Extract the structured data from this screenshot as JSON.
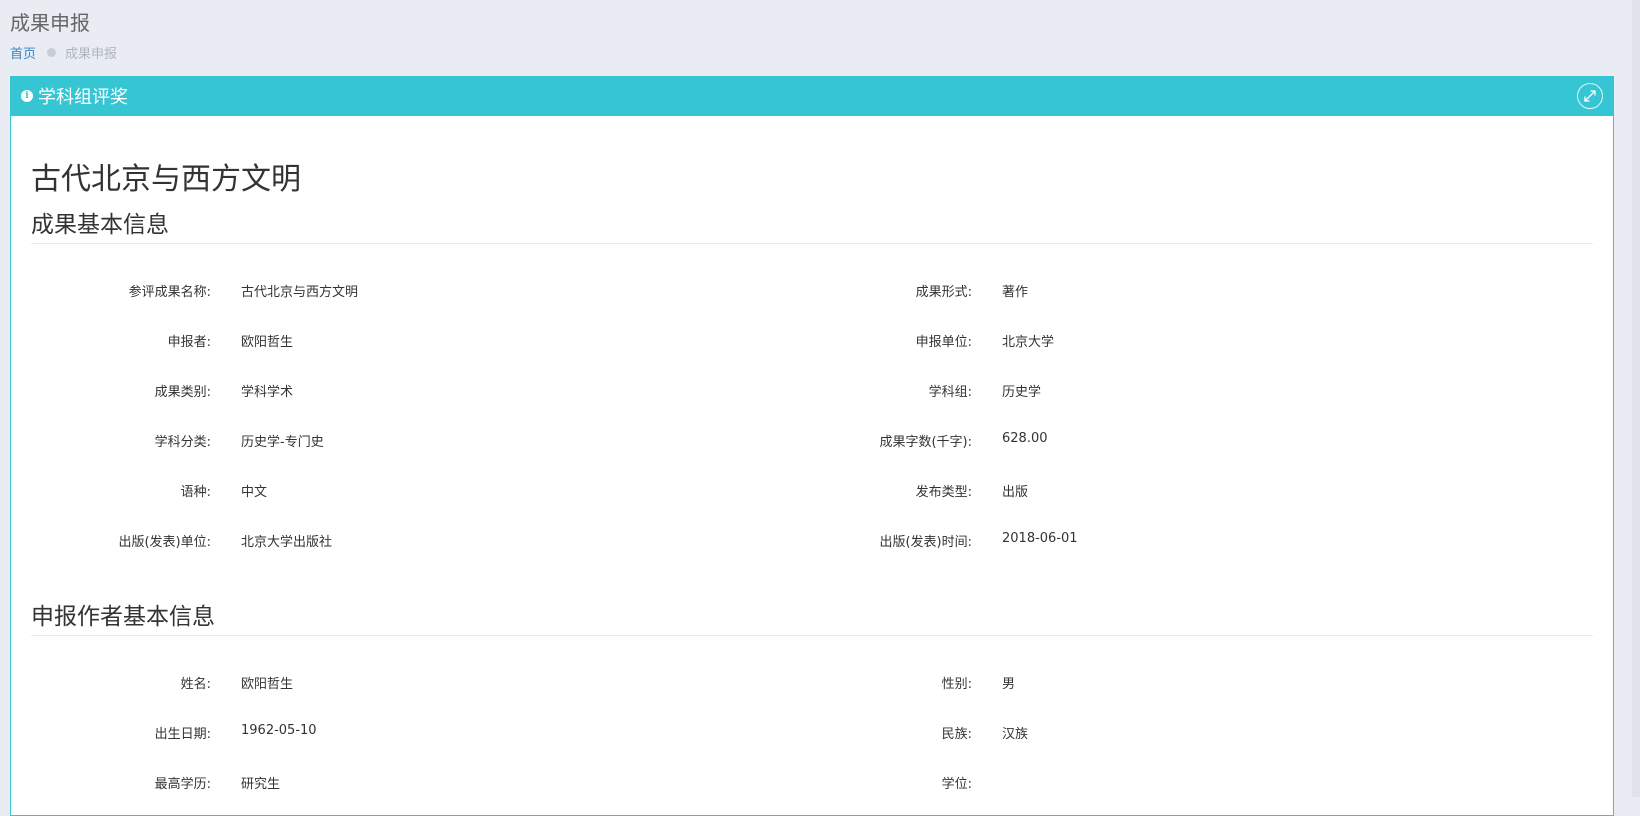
{
  "header": {
    "title": "成果申报",
    "breadcrumb": {
      "home": "首页",
      "current": "成果申报"
    }
  },
  "panel": {
    "title": "学科组评奖",
    "icons": {
      "info": "info-icon",
      "expand": "expand-icon"
    },
    "accent_color": "#36c6d3"
  },
  "doc_title": "古代北京与西方文明",
  "basic_info": {
    "section_title": "成果基本信息",
    "rows": [
      {
        "left_label": "参评成果名称:",
        "left_value": "古代北京与西方文明",
        "right_label": "成果形式:",
        "right_value": "著作"
      },
      {
        "left_label": "申报者:",
        "left_value": "欧阳哲生",
        "right_label": "申报单位:",
        "right_value": "北京大学"
      },
      {
        "left_label": "成果类别:",
        "left_value": "学科学术",
        "right_label": "学科组:",
        "right_value": "历史学"
      },
      {
        "left_label": "学科分类:",
        "left_value": "历史学-专门史",
        "right_label": "成果字数(千字):",
        "right_value": "628.00"
      },
      {
        "left_label": "语种:",
        "left_value": "中文",
        "right_label": "发布类型:",
        "right_value": "出版"
      },
      {
        "left_label": "出版(发表)单位:",
        "left_value": "北京大学出版社",
        "right_label": "出版(发表)时间:",
        "right_value": "2018-06-01"
      }
    ]
  },
  "author_info": {
    "section_title": "申报作者基本信息",
    "rows": [
      {
        "left_label": "姓名:",
        "left_value": "欧阳哲生",
        "right_label": "性别:",
        "right_value": "男"
      },
      {
        "left_label": "出生日期:",
        "left_value": "1962-05-10",
        "right_label": "民族:",
        "right_value": "汉族"
      },
      {
        "left_label": "最高学历:",
        "left_value": "研究生",
        "right_label": "学位:",
        "right_value": ""
      }
    ]
  }
}
